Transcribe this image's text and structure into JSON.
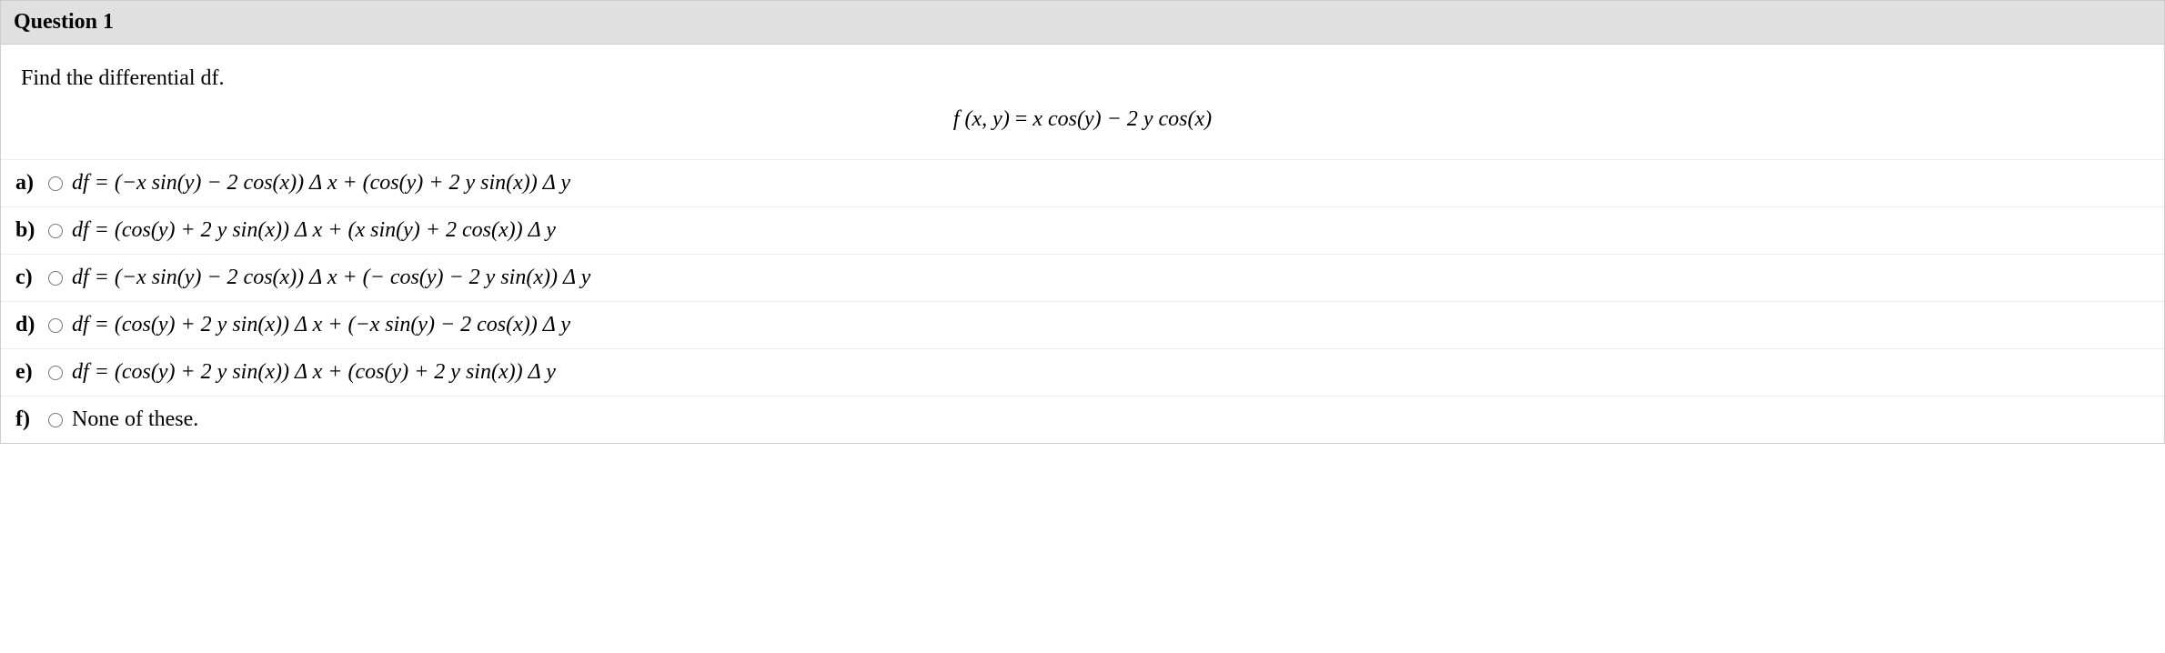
{
  "question": {
    "title": "Question 1",
    "prompt": "Find the differential df.",
    "formula_lhs": "f (x, y)",
    "formula_rhs": "x cos(y) − 2 y cos(x)"
  },
  "options": {
    "a": {
      "label": "a)",
      "text": "df = (−x sin(y) − 2  cos(x)) Δ x + (cos(y) + 2 y sin(x)) Δ y"
    },
    "b": {
      "label": "b)",
      "text": "df = (cos(y) + 2 y sin(x)) Δ x + (x sin(y) + 2  cos(x)) Δ y"
    },
    "c": {
      "label": "c)",
      "text": "df = (−x sin(y) − 2  cos(x)) Δ x + (− cos(y) − 2 y sin(x)) Δ y"
    },
    "d": {
      "label": "d)",
      "text": "df = (cos(y) + 2 y sin(x)) Δ x + (−x sin(y) − 2  cos(x)) Δ y"
    },
    "e": {
      "label": "e)",
      "text": "df = (cos(y) + 2 y sin(x)) Δ x + (cos(y) + 2 y sin(x)) Δ y"
    },
    "f": {
      "label": "f)",
      "text": "None of these."
    }
  }
}
